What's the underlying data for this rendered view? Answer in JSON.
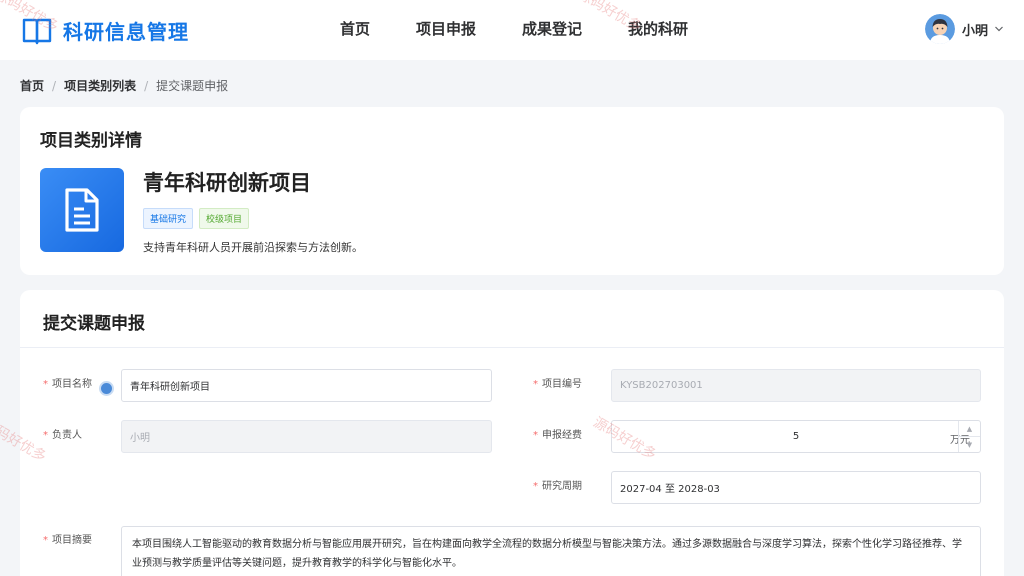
{
  "app": {
    "title": "科研信息管理",
    "brand_color": "#1677e6"
  },
  "nav": {
    "items": [
      {
        "label": "首页"
      },
      {
        "label": "项目申报"
      },
      {
        "label": "成果登记"
      },
      {
        "label": "我的科研"
      }
    ]
  },
  "user": {
    "name": "小明",
    "avatar_icon": "avatar-icon",
    "dropdown_icon": "chevron-down-icon"
  },
  "breadcrumb": {
    "items": [
      {
        "label": "首页"
      },
      {
        "label": "项目类别列表"
      },
      {
        "label": "提交课题申报"
      }
    ],
    "separator": "/"
  },
  "detail": {
    "section_title": "项目类别详情",
    "icon": "document-icon",
    "name": "青年科研创新项目",
    "tags": [
      "基础研究",
      "校级项目"
    ],
    "description": "支持青年科研人员开展前沿探索与方法创新。"
  },
  "form": {
    "section_title": "提交课题申报",
    "required_mark": "*",
    "project_name": {
      "label": "项目名称",
      "value": "青年科研创新项目"
    },
    "project_code": {
      "label": "项目编号",
      "value": "KYSB202703001"
    },
    "leader": {
      "label": "负责人",
      "value": "小明"
    },
    "budget": {
      "label": "申报经费",
      "value": "5",
      "unit": "万元"
    },
    "period": {
      "label": "研究周期",
      "value": "2027-04 至 2028-03"
    },
    "abstract": {
      "label": "项目摘要",
      "value": "本项目围绕人工智能驱动的教育数据分析与智能应用展开研究，旨在构建面向教学全流程的数据分析模型与智能决策方法。通过多源数据融合与深度学习算法，探索个性化学习路径推荐、学业预测与教学质量评估等关键问题，提升教育教学的科学化与智能化水平。"
    }
  },
  "watermark": "源码好优多"
}
